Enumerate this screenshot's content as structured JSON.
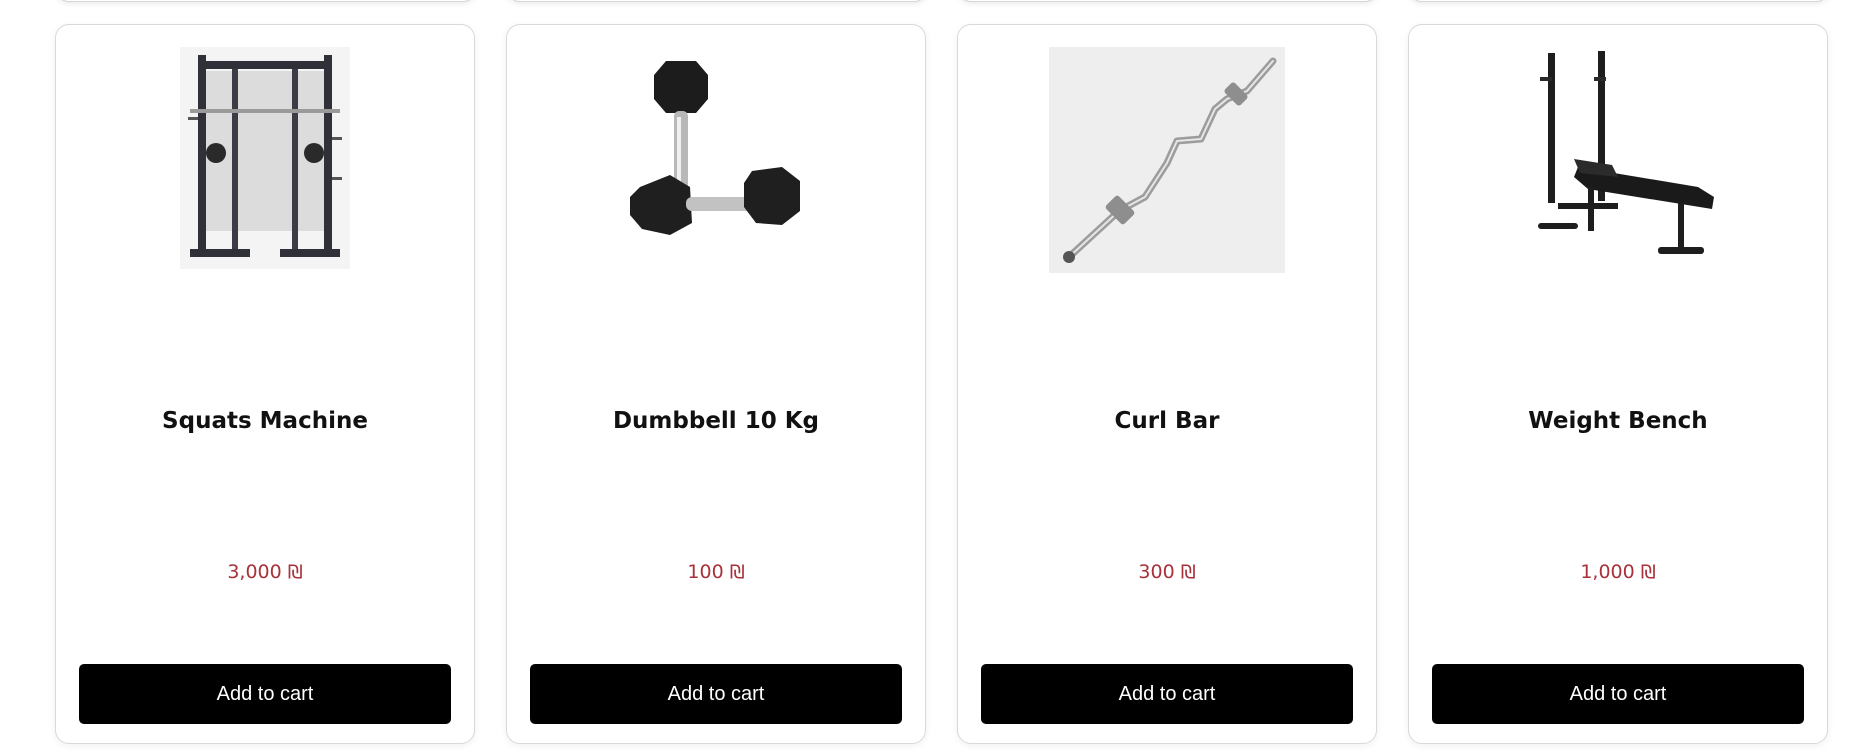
{
  "products": [
    {
      "title": "Squats Machine",
      "price": "3,000 ₪",
      "button_label": "Add to cart",
      "image_icon": "smith-machine-image"
    },
    {
      "title": "Dumbbell 10 Kg",
      "price": "100 ₪",
      "button_label": "Add to cart",
      "image_icon": "dumbbell-image"
    },
    {
      "title": "Curl Bar",
      "price": "300 ₪",
      "button_label": "Add to cart",
      "image_icon": "curl-bar-image"
    },
    {
      "title": "Weight Bench",
      "price": "1,000 ₪",
      "button_label": "Add to cart",
      "image_icon": "weight-bench-image"
    }
  ],
  "colors": {
    "price": "#a8323a",
    "button_bg": "#000000",
    "button_text": "#ffffff",
    "card_border": "#d9d9d9"
  }
}
